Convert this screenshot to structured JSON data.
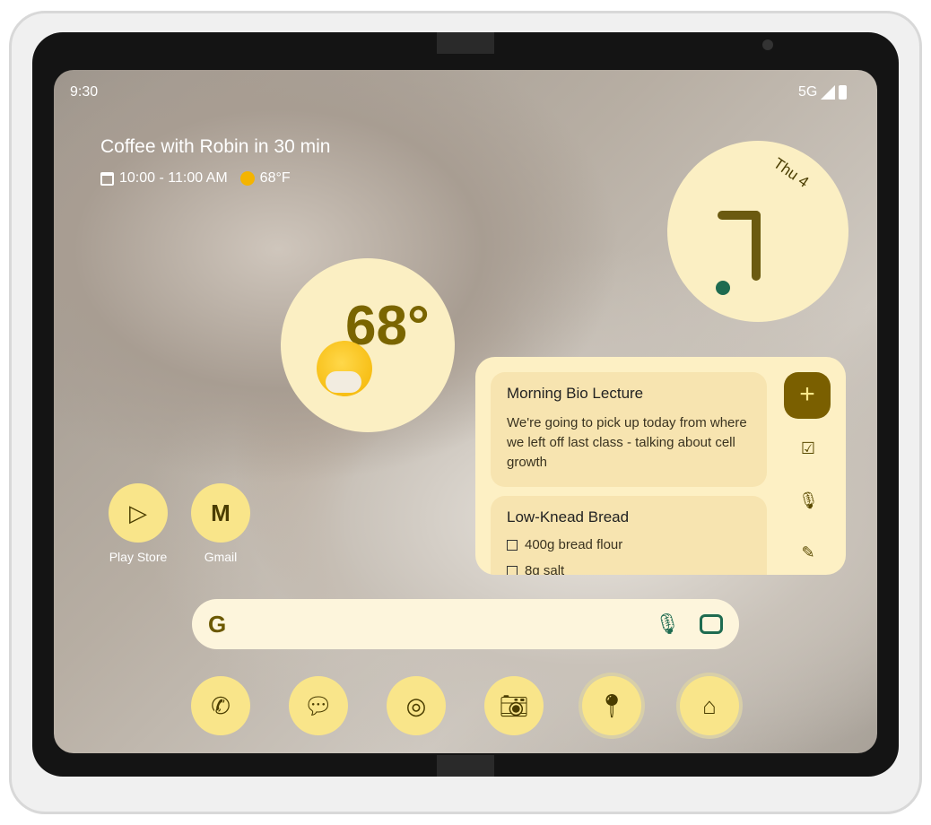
{
  "status": {
    "time": "9:30",
    "network": "5G"
  },
  "at_a_glance": {
    "title": "Coffee with Robin in 30 min",
    "event_time": "10:00 - 11:00 AM",
    "weather": "68°F"
  },
  "clock": {
    "date": "Thu 4"
  },
  "weather_widget": {
    "temperature": "68°"
  },
  "notes": {
    "cards": [
      {
        "title": "Morning Bio Lecture",
        "body": "We're going to pick up today from where we left off last class - talking about cell growth"
      },
      {
        "title": "Low-Knead Bread",
        "items": [
          "400g bread flour",
          "8g salt"
        ]
      }
    ]
  },
  "apps": [
    {
      "label": "Play Store",
      "icon": "play-store-icon"
    },
    {
      "label": "Gmail",
      "icon": "gmail-icon"
    }
  ],
  "search": {
    "logo": "G"
  },
  "dock": [
    "phone-icon",
    "messages-icon",
    "chrome-icon",
    "camera-icon",
    "maps-icon",
    "home-icon"
  ],
  "colors": {
    "accent": "#7a5f00",
    "widget_bg": "#fbefc3",
    "icon_bg": "#f9e58a"
  }
}
